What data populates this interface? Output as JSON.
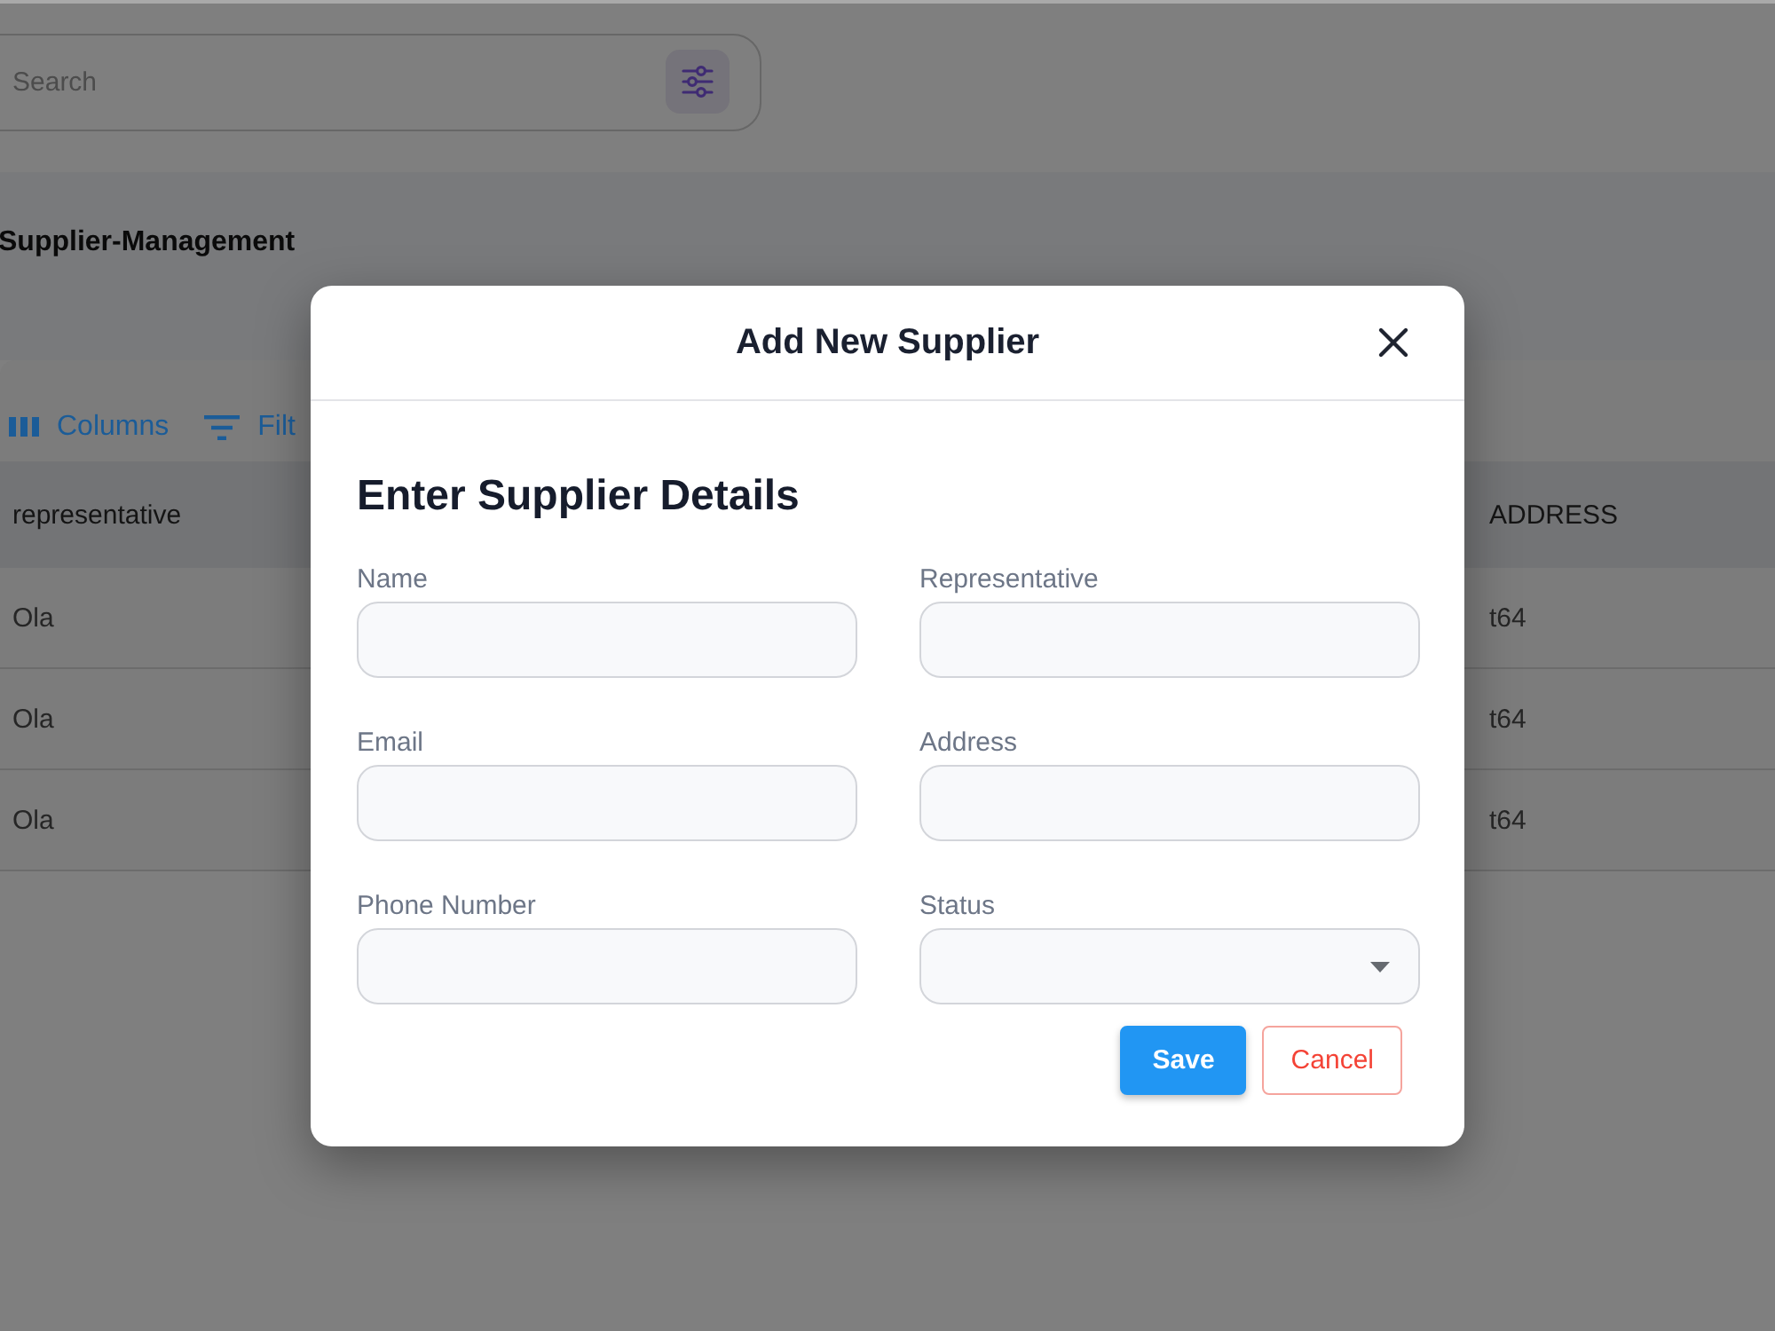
{
  "search": {
    "placeholder": "Search"
  },
  "page_title": "Supplier-Management",
  "toolbar": [
    {
      "kind": "columns",
      "label": "Columns"
    },
    {
      "kind": "filters",
      "label": "Filt"
    }
  ],
  "table": {
    "columns": [
      "representative",
      "ADDRESS"
    ],
    "rows": [
      {
        "cells": [
          "Ola",
          "t64"
        ]
      },
      {
        "cells": [
          "Ola",
          "t64"
        ]
      },
      {
        "cells": [
          "Ola",
          "t64"
        ]
      }
    ]
  },
  "dialog": {
    "title": "Add New Supplier",
    "heading": "Enter Supplier Details",
    "fields": [
      {
        "label": "Name",
        "kind": "text"
      },
      {
        "label": "Representative",
        "kind": "text"
      },
      {
        "label": "Email",
        "kind": "text"
      },
      {
        "label": "Address",
        "kind": "text"
      },
      {
        "label": "Phone Number",
        "kind": "text"
      },
      {
        "label": "Status",
        "kind": "select"
      }
    ],
    "buttons": [
      {
        "label": "Save",
        "kind": "primary"
      },
      {
        "label": "Cancel",
        "kind": "secondary"
      }
    ]
  }
}
